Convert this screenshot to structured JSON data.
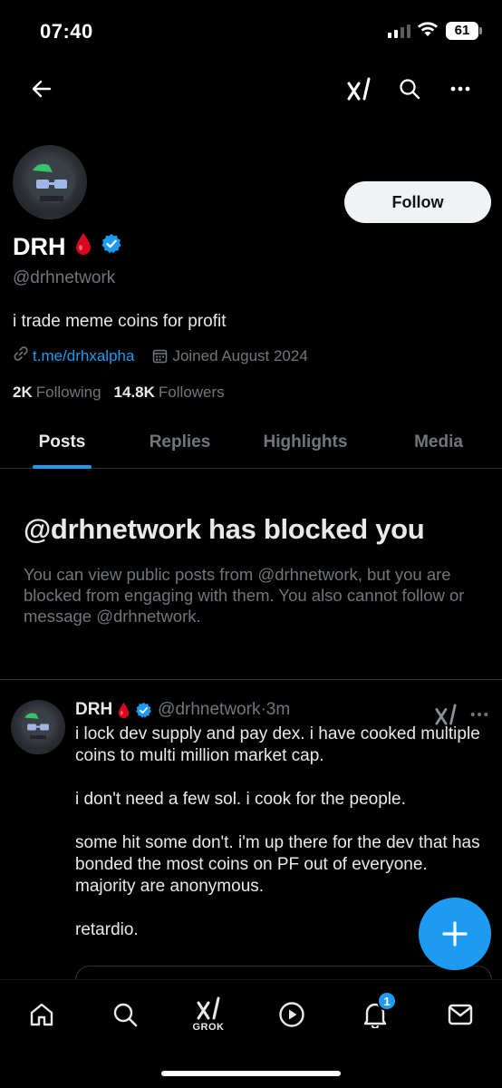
{
  "status_bar": {
    "time": "07:40",
    "battery": "61"
  },
  "profile": {
    "display_name": "DRH",
    "name_emoji": "🩸",
    "handle": "@drhnetwork",
    "bio": "i trade meme coins for profit",
    "link": "t.me/drhxalpha",
    "joined": "Joined August 2024",
    "following_count": "2K",
    "following_label": "Following",
    "followers_count": "14.8K",
    "followers_label": "Followers",
    "follow_label": "Follow"
  },
  "tabs": [
    {
      "label": "Posts",
      "active": true
    },
    {
      "label": "Replies",
      "active": false
    },
    {
      "label": "Highlights",
      "active": false
    },
    {
      "label": "Media",
      "active": false
    }
  ],
  "blocked": {
    "title": "@drhnetwork has blocked you",
    "description": "You can view public posts from @drhnetwork, but you are blocked from engaging with them. You also cannot follow or message @drhnetwork."
  },
  "post": {
    "name": "DRH",
    "name_emoji": "🩸",
    "handle": "@drhnetwork",
    "time": "3m",
    "separator": "·",
    "paragraphs": [
      "i lock dev supply and pay dex. i have cooked multiple coins to multi million market cap.",
      "i don't need a few sol. i cook for the people.",
      "some hit some don't. i'm up there for the dev that has bonded the most coins on PF out of everyone. majority are anonymous.",
      "retardio."
    ]
  },
  "bottom_nav": {
    "grok_label": "GROK",
    "notifications_badge": "1"
  },
  "colors": {
    "accent": "#1d9bf0",
    "background": "#000000",
    "muted": "#71767b",
    "text": "#e7e9ea"
  }
}
